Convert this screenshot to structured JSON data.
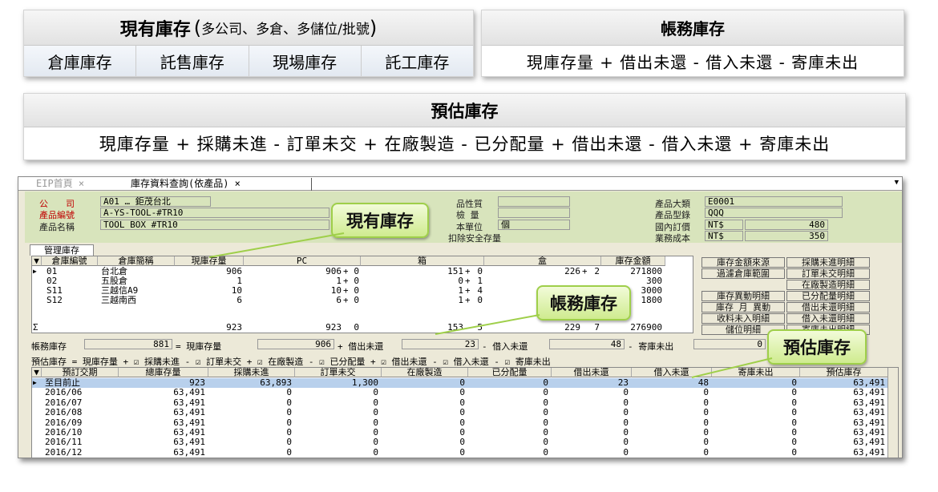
{
  "top": {
    "current": {
      "title": "現有庫存",
      "paren_open": "(",
      "detail": "多公司、多倉、多儲位/批號",
      "paren_close": ")",
      "cells": [
        "倉庫庫存",
        "託售庫存",
        "現場庫存",
        "託工庫存"
      ]
    },
    "account": {
      "title": "帳務庫存",
      "formula": "現庫存量 + 借出未還 - 借入未還 - 寄庫未出"
    },
    "estimate": {
      "title": "預估庫存",
      "formula": "現庫存量 + 採購未進 - 訂單未交 + 在廠製造 - 已分配量 + 借出未還 - 借入未還 + 寄庫未出"
    }
  },
  "tabs": [
    "EIP首頁 ×",
    "庫存資料查詢(依產品) ×"
  ],
  "header": {
    "company_label": "公　　司",
    "company_value": "A01 … 鉅茂台北",
    "product_no_label": "產品編號",
    "product_no_value": "A-YS-TOOL-#TR10",
    "product_name_label": "產品名稱",
    "product_name_value": "TOOL BOX #TR10",
    "attr_label": "品性質",
    "qty_label": "檢 量",
    "unit_label": "本單位",
    "unit_value": "個",
    "safety_label": "扣除安全存量",
    "category_label": "產品大類",
    "category_value": "E0001",
    "model_label": "產品型錄",
    "model_value": "QQQ",
    "domestic_label": "國內訂價",
    "domestic_cur": "NT$",
    "domestic_value": "480",
    "cost_label": "業務成本",
    "cost_cur": "NT$",
    "cost_value": "350"
  },
  "mgmt_tab": "管理庫存",
  "grid1": {
    "headers": [
      "倉庫編號",
      "倉庫簡稱",
      "現庫存量",
      "PC",
      "箱",
      "盒",
      "庫存金額"
    ],
    "rows": [
      [
        "01",
        "台北倉",
        "906",
        "906",
        "0",
        "151",
        "0",
        "226",
        "2",
        "271800"
      ],
      [
        "02",
        "五股倉",
        "1",
        "1",
        "0",
        "0",
        "1",
        "",
        "",
        "300"
      ],
      [
        "S11",
        "三越信A9",
        "10",
        "10",
        "0",
        "1",
        "4",
        "",
        "",
        "3000"
      ],
      [
        "S12",
        "三越南西",
        "6",
        "6",
        "0",
        "1",
        "0",
        "",
        "",
        "1800"
      ]
    ],
    "sum_label": "Σ",
    "totals": [
      "923",
      "923",
      "0",
      "153",
      "5",
      "229",
      "7",
      "276900"
    ]
  },
  "buttons": [
    "庫存金額來源",
    "採購未進明細",
    "過濾倉庫範圍",
    "訂單未交明細",
    "在廠製造明細",
    "庫存異動明細",
    "已分配量明細",
    "庫存 月 異動",
    "借出未還明細",
    "收料未入明細",
    "借入未還明細",
    "儲位明細",
    "寄庫未出明細"
  ],
  "account_row": {
    "label": "帳務庫存",
    "v1": "881",
    "t1": "= 現庫存量",
    "v2": "906",
    "t2": "+ 借出未還",
    "v3": "23",
    "t3": "- 借入未還",
    "v4": "48",
    "t4": "- 寄庫未出",
    "v5": "0"
  },
  "estimate_row": {
    "label": "預估庫存 = 現庫存量 +",
    "items": [
      "☑ 採購未進 -",
      "☑ 訂單未交 +",
      "☑ 在廠製造 -",
      "☑ 已分配量 +",
      "☑ 借出未還 -",
      "☑ 借入未還 -",
      "☑ 寄庫未出"
    ]
  },
  "grid2": {
    "headers": [
      "預訂交期",
      "總庫存量",
      "採購未進",
      "訂單未交",
      "在廠製造",
      "已分配量",
      "借出未還",
      "借入未還",
      "寄庫未出",
      "預估庫存"
    ],
    "rows": [
      [
        "至目前止",
        "923",
        "63,893",
        "1,300",
        "0",
        "0",
        "23",
        "48",
        "0",
        "63,491"
      ],
      [
        "2016/06",
        "63,491",
        "0",
        "0",
        "0",
        "0",
        "0",
        "0",
        "0",
        "63,491"
      ],
      [
        "2016/07",
        "63,491",
        "0",
        "0",
        "0",
        "0",
        "0",
        "0",
        "0",
        "63,491"
      ],
      [
        "2016/08",
        "63,491",
        "0",
        "0",
        "0",
        "0",
        "0",
        "0",
        "0",
        "63,491"
      ],
      [
        "2016/09",
        "63,491",
        "0",
        "0",
        "0",
        "0",
        "0",
        "0",
        "0",
        "63,491"
      ],
      [
        "2016/10",
        "63,491",
        "0",
        "0",
        "0",
        "0",
        "0",
        "0",
        "0",
        "63,491"
      ],
      [
        "2016/11",
        "63,491",
        "0",
        "0",
        "0",
        "0",
        "0",
        "0",
        "0",
        "63,491"
      ],
      [
        "2016/12",
        "63,491",
        "0",
        "0",
        "0",
        "0",
        "0",
        "0",
        "0",
        "63,491"
      ]
    ]
  },
  "callouts": {
    "current": "現有庫存",
    "account": "帳務庫存",
    "estimate": "預估庫存"
  },
  "colors": {
    "header_bg": "#d8e4bc",
    "selected_row": "#b8d0ec",
    "callout_border": "#9fcf4a",
    "label_red": "#c00000"
  }
}
